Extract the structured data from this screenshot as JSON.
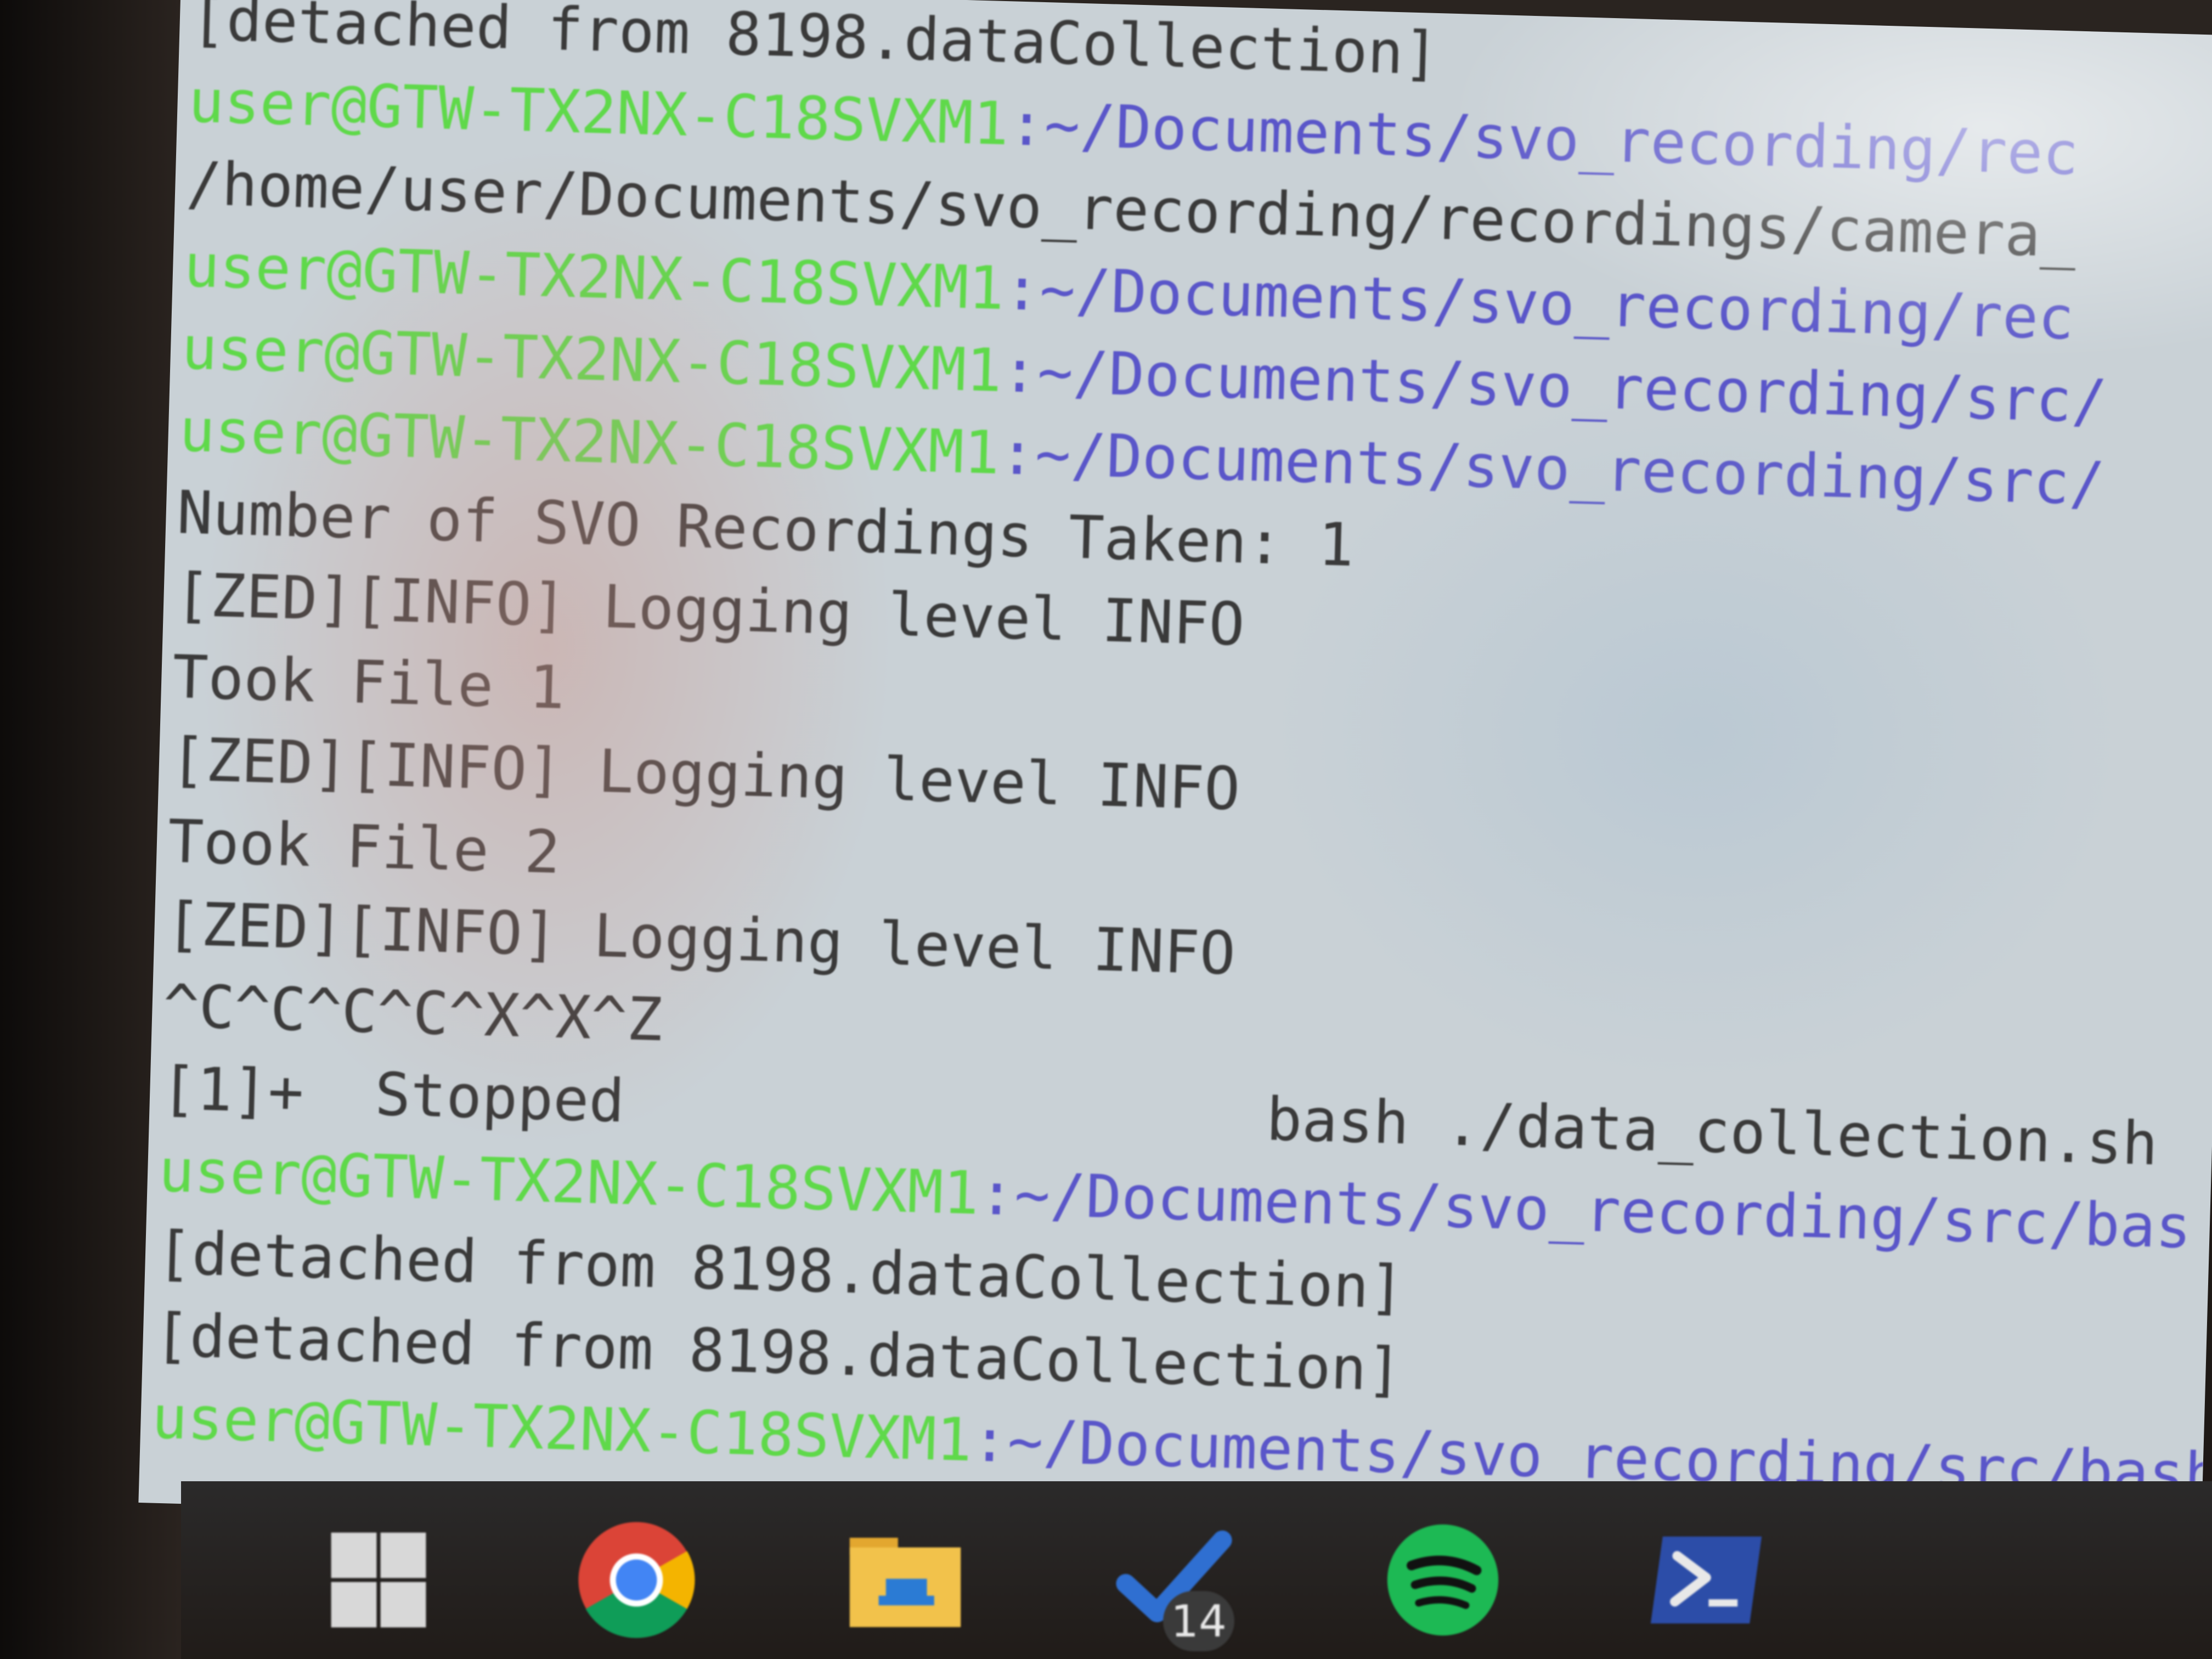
{
  "terminal": {
    "lines": [
      {
        "kind": "output",
        "text": "[detached from 8198.dataCollection]"
      },
      {
        "kind": "prompt",
        "user": "user@GTW-TX2NX-C18SVXM1",
        "path": ":~/Documents/svo_recording/rec"
      },
      {
        "kind": "output",
        "text": "/home/user/Documents/svo_recording/recordings/camera_"
      },
      {
        "kind": "prompt",
        "user": "user@GTW-TX2NX-C18SVXM1",
        "path": ":~/Documents/svo_recording/rec"
      },
      {
        "kind": "prompt",
        "user": "user@GTW-TX2NX-C18SVXM1",
        "path": ":~/Documents/svo_recording/src/"
      },
      {
        "kind": "prompt",
        "user": "user@GTW-TX2NX-C18SVXM1",
        "path": ":~/Documents/svo_recording/src/"
      },
      {
        "kind": "output",
        "text": "Number of SVO Recordings Taken: 1"
      },
      {
        "kind": "output",
        "text": "[ZED][INFO] Logging level INFO"
      },
      {
        "kind": "output",
        "text": "Took File 1"
      },
      {
        "kind": "output",
        "text": "[ZED][INFO] Logging level INFO"
      },
      {
        "kind": "output",
        "text": "Took File 2"
      },
      {
        "kind": "output",
        "text": "[ZED][INFO] Logging level INFO"
      },
      {
        "kind": "output",
        "text": "^C^C^C^C^X^X^Z"
      },
      {
        "kind": "output",
        "text": "[1]+  Stopped                  bash ./data_collection.sh"
      },
      {
        "kind": "prompt",
        "user": "user@GTW-TX2NX-C18SVXM1",
        "path": ":~/Documents/svo_recording/src/bas"
      },
      {
        "kind": "output",
        "text": "[detached from 8198.dataCollection]"
      },
      {
        "kind": "output",
        "text": "[detached from 8198.dataCollection]"
      },
      {
        "kind": "prompt",
        "user": "user@GTW-TX2NX-C18SVXM1",
        "path": ":~/Documents/svo_recording/src/bash"
      }
    ]
  },
  "taskbar": {
    "items": [
      {
        "name": "windows-start-icon"
      },
      {
        "name": "chrome-icon"
      },
      {
        "name": "file-explorer-icon"
      },
      {
        "name": "todo-icon",
        "badge": "14"
      },
      {
        "name": "spotify-icon"
      },
      {
        "name": "powershell-icon"
      }
    ]
  },
  "colors": {
    "prompt_user": "#5fd94a",
    "prompt_path": "#5a56c9",
    "output_text": "#3a3a3a",
    "terminal_bg": "#c9d1d6"
  }
}
